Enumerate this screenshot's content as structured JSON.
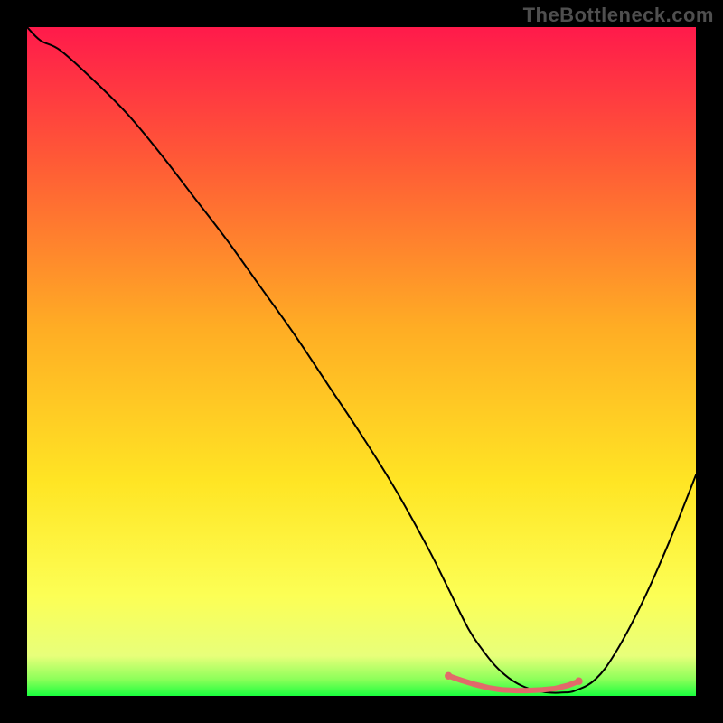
{
  "watermark": "TheBottleneck.com",
  "chart_data": {
    "type": "line",
    "title": "",
    "xlabel": "",
    "ylabel": "",
    "xlim": [
      0,
      100
    ],
    "ylim": [
      0,
      100
    ],
    "grid": false,
    "legend": false,
    "gradient_stops": [
      {
        "offset": 0.0,
        "color": "#ff1a4b"
      },
      {
        "offset": 0.2,
        "color": "#ff5a36"
      },
      {
        "offset": 0.45,
        "color": "#ffad24"
      },
      {
        "offset": 0.68,
        "color": "#ffe524"
      },
      {
        "offset": 0.85,
        "color": "#fcff55"
      },
      {
        "offset": 0.94,
        "color": "#e8ff7a"
      },
      {
        "offset": 0.975,
        "color": "#8dff5a"
      },
      {
        "offset": 1.0,
        "color": "#1aff3e"
      }
    ],
    "series": [
      {
        "name": "bottleneck-curve",
        "color": "#000000",
        "x": [
          0,
          2,
          5,
          10,
          15,
          20,
          25,
          30,
          35,
          40,
          45,
          50,
          55,
          60,
          63,
          66,
          68,
          70,
          72,
          74,
          76,
          78,
          80,
          82,
          85,
          88,
          92,
          96,
          100
        ],
        "y": [
          100,
          98,
          96.5,
          92,
          87,
          81,
          74.5,
          68,
          61,
          54,
          46.5,
          39,
          31,
          22,
          16,
          10,
          7,
          4.5,
          2.7,
          1.5,
          0.8,
          0.5,
          0.5,
          0.8,
          2.5,
          6.5,
          14,
          23,
          33
        ]
      },
      {
        "name": "optimal-zone",
        "color": "#e26a6a",
        "stroke_width": 6,
        "x": [
          63,
          65,
          67,
          69,
          71,
          73,
          75,
          77,
          79,
          81,
          82.5
        ],
        "y": [
          3.0,
          2.3,
          1.7,
          1.2,
          0.9,
          0.8,
          0.8,
          0.9,
          1.1,
          1.6,
          2.2
        ]
      }
    ]
  }
}
